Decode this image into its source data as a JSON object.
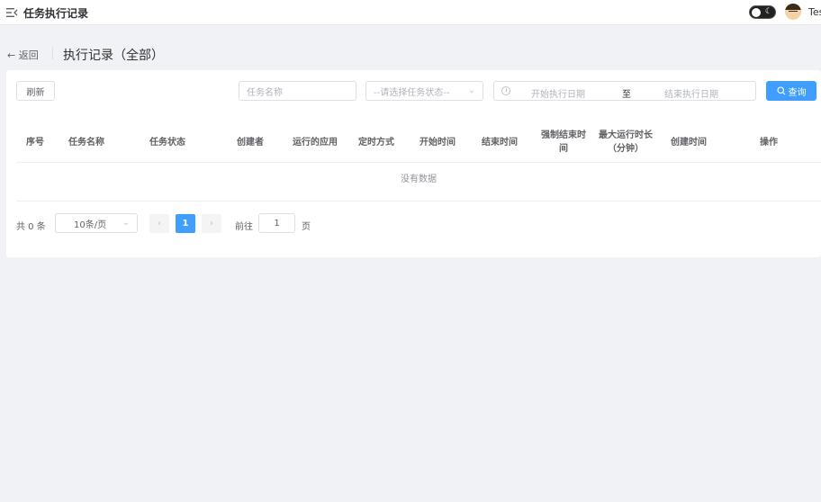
{
  "header": {
    "app_title": "任务执行记录",
    "user_name": "Test",
    "theme_moon": "☾"
  },
  "page": {
    "back_label": "← 返回",
    "title": "执行记录（全部）"
  },
  "filters": {
    "refresh_label": "刷新",
    "task_name_placeholder": "任务名称",
    "status_placeholder": "--请选择任务状态--",
    "date_start_placeholder": "开始执行日期",
    "date_separator": "至",
    "date_end_placeholder": "结束执行日期",
    "query_label": "查询"
  },
  "table": {
    "columns": [
      "序号",
      "任务名称",
      "任务状态",
      "创建者",
      "运行的应用",
      "定时方式",
      "开始时间",
      "结束时间",
      "强制结束时间",
      "最大运行时长（分钟）",
      "创建时间",
      "操作"
    ],
    "empty_text": "没有数据"
  },
  "pagination": {
    "total_text": "共 0 条",
    "page_size": "10条/页",
    "prev": "‹",
    "current_page": "1",
    "next": "›",
    "goto_label": "前往",
    "goto_value": "1",
    "goto_suffix": "页"
  }
}
